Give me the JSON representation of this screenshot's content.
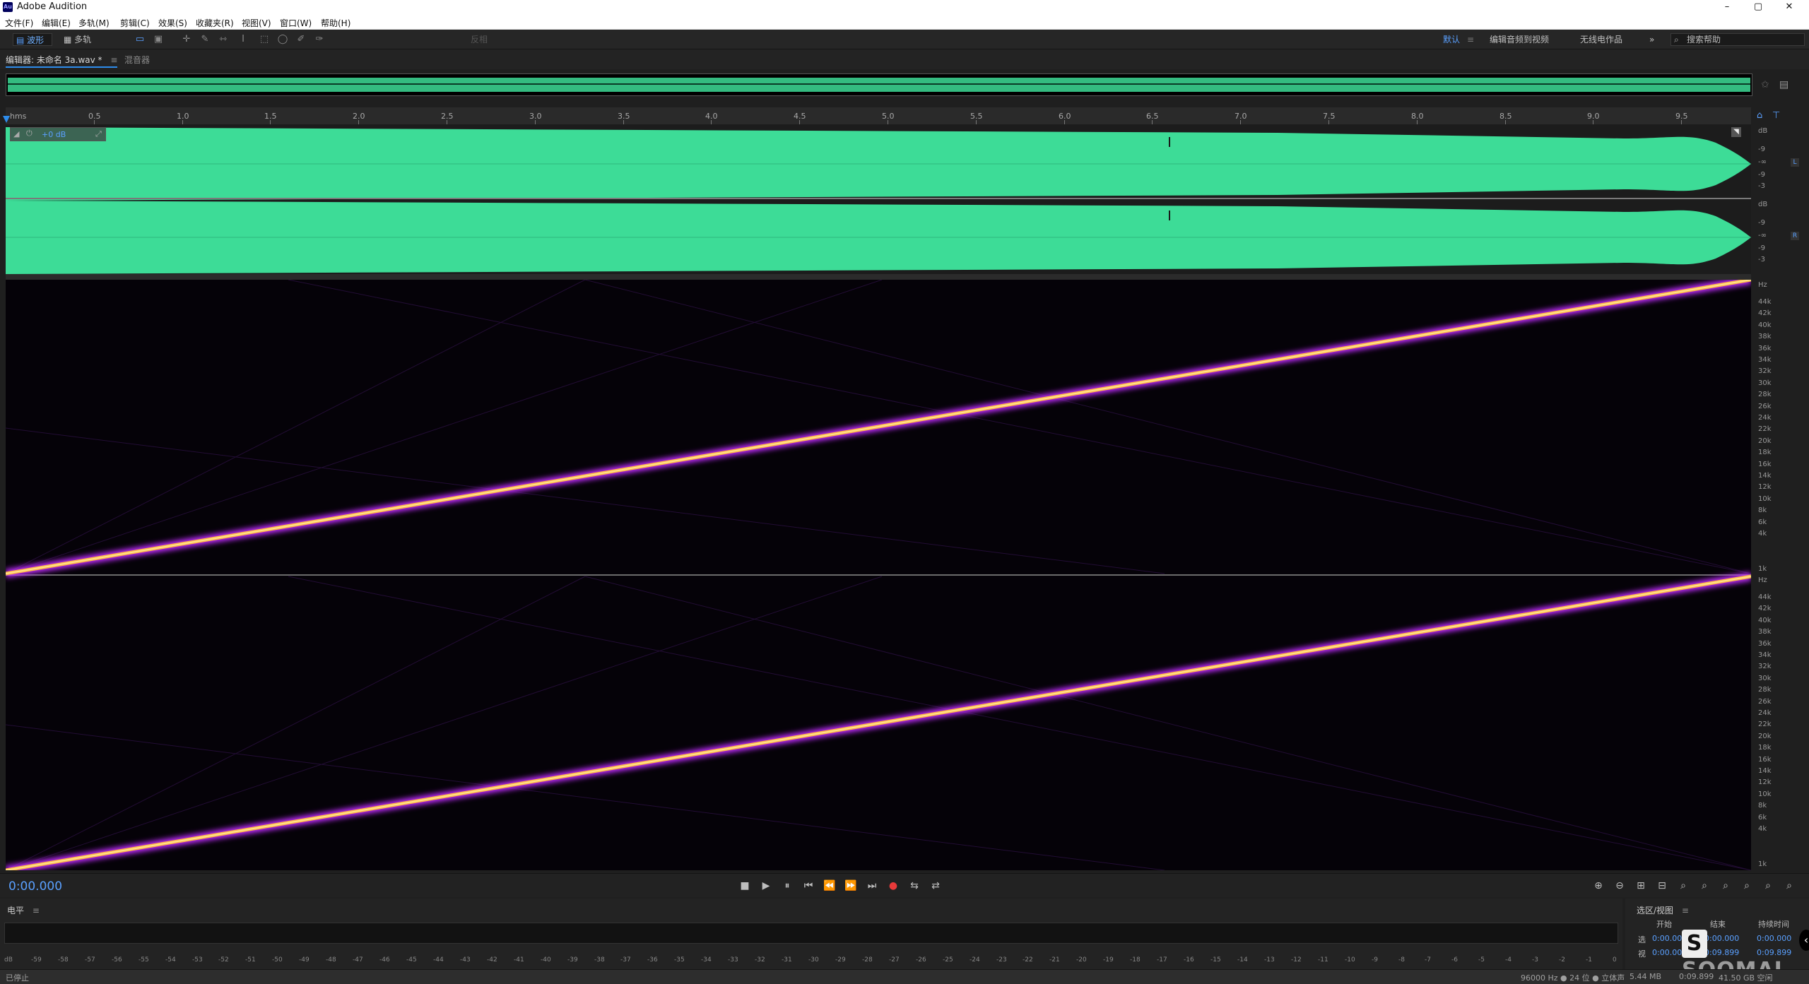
{
  "window": {
    "app_title": "Adobe Audition",
    "logo_text": "Au",
    "minimize": "–",
    "maximize": "▢",
    "close": "✕"
  },
  "menu": [
    "文件(F)",
    "编辑(E)",
    "多轨(M)",
    "剪辑(C)",
    "效果(S)",
    "收藏夹(R)",
    "视图(V)",
    "窗口(W)",
    "帮助(H)"
  ],
  "toolbar": {
    "waveform_label": "波形",
    "multitrack_label": "多轨",
    "mode_label": "反相",
    "workspaces": [
      "默认",
      "编辑音频到视频",
      "无线电作品"
    ],
    "more": "»",
    "search_placeholder": "搜索帮助"
  },
  "editor": {
    "tab_label": "编辑器: 未命名 3a.wav *",
    "tab_mixer": "混音器",
    "gain_label": "+0 dB",
    "time_unit": "hms"
  },
  "ruler": {
    "labels": [
      "0.5",
      "1.0",
      "1.5",
      "2.0",
      "2.5",
      "3.0",
      "3.5",
      "4.0",
      "4.5",
      "5.0",
      "5.5",
      "6.0",
      "6.5",
      "7.0",
      "7.5",
      "8.0",
      "8.5",
      "9.0",
      "9.5"
    ]
  },
  "amp_scale": {
    "unit": "dB",
    "ticks": [
      "-9",
      "-∞",
      "-9",
      "-3"
    ]
  },
  "freq_scale": {
    "unit": "Hz",
    "ticks": [
      "44k",
      "42k",
      "40k",
      "38k",
      "36k",
      "34k",
      "32k",
      "30k",
      "28k",
      "26k",
      "24k",
      "22k",
      "20k",
      "18k",
      "16k",
      "14k",
      "12k",
      "10k",
      "8k",
      "6k",
      "4k",
      "1k"
    ]
  },
  "channels": {
    "left": "L",
    "right": "R"
  },
  "transport": {
    "timecode": "0:00.000",
    "buttons": [
      "■",
      "▶",
      "⏸",
      "⏮",
      "⏪",
      "⏩",
      "⏭",
      "●",
      "⇆",
      "⇄"
    ]
  },
  "levels": {
    "title": "电平",
    "ticks": [
      "dB",
      "-59",
      "-58",
      "-57",
      "-56",
      "-55",
      "-54",
      "-53",
      "-52",
      "-51",
      "-50",
      "-49",
      "-48",
      "-47",
      "-46",
      "-45",
      "-44",
      "-43",
      "-42",
      "-41",
      "-40",
      "-39",
      "-38",
      "-37",
      "-36",
      "-35",
      "-34",
      "-33",
      "-32",
      "-31",
      "-30",
      "-29",
      "-28",
      "-27",
      "-26",
      "-25",
      "-24",
      "-23",
      "-22",
      "-21",
      "-20",
      "-19",
      "-18",
      "-17",
      "-16",
      "-15",
      "-14",
      "-13",
      "-12",
      "-11",
      "-10",
      "-9",
      "-8",
      "-7",
      "-6",
      "-5",
      "-4",
      "-3",
      "-2",
      "-1",
      "0"
    ]
  },
  "selection_view": {
    "title": "选区/视图",
    "col_start": "开始",
    "col_end": "结束",
    "col_duration": "持续时间",
    "row_selection": "选",
    "row_view": "视",
    "sel_start": "0:00.000",
    "sel_end": "0:00.000",
    "sel_duration": "0:00.000",
    "view_start": "0:00.000",
    "view_end": "0:09.899",
    "view_duration": "0:09.899"
  },
  "status": {
    "left": "已停止",
    "sample_info": "96000 Hz ● 24 位 ● 立体声",
    "size": "5.44 MB",
    "duration": "0:09.899",
    "free": "41.50 GB 空闲"
  },
  "watermark": "SOOMAL",
  "colors": {
    "waveform": "#3ddc97",
    "spectral_line": "#ffe38a",
    "spectral_glow": "#c02cff",
    "accent": "#2d8ceb"
  }
}
